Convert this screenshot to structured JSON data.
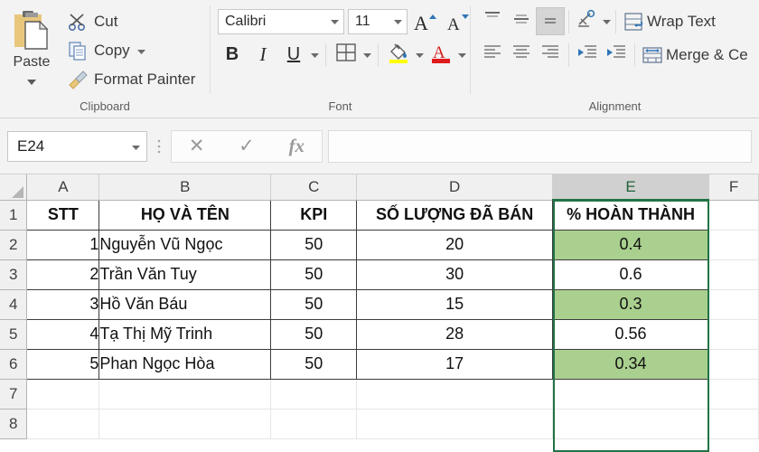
{
  "ribbon": {
    "clipboard": {
      "label": "Clipboard",
      "paste": {
        "label": "Paste",
        "icon": "clipboard-icon",
        "caret": "▾"
      },
      "commands": [
        {
          "label": "Cut",
          "icon": "scissors-icon",
          "caret": ""
        },
        {
          "label": "Copy",
          "icon": "copy-icon",
          "caret": "▾"
        },
        {
          "label": "Format Painter",
          "icon": "paintbrush-icon",
          "caret": ""
        }
      ]
    },
    "font": {
      "label": "Font",
      "font_name": "Calibri",
      "font_size": "11",
      "caret": "▾",
      "grow_font": "A",
      "shrink_font": "A",
      "bold": "B",
      "italic": "I",
      "underline": "U",
      "borders_icon": "borders-icon",
      "fill_color_icon": "fill-color-icon",
      "font_color_icon": "font-color-icon",
      "font_color_swatch": "#e01b1b",
      "fill_color_swatch": "#ffff00"
    },
    "alignment": {
      "label": "Alignment",
      "top_align": "top-align-icon",
      "middle_align": "middle-align-icon",
      "bottom_align": "bottom-align-icon",
      "orientation": "orientation-icon",
      "align_left": "align-left-icon",
      "align_center": "align-center-icon",
      "align_right": "align-right-icon",
      "decrease_indent": "decrease-indent-icon",
      "increase_indent": "increase-indent-icon",
      "wrap_text": "Wrap Text",
      "merge_center": "Merge & Ce"
    }
  },
  "formula_bar": {
    "name_box": "E24",
    "caret": "▾",
    "cancel": "✕",
    "enter": "✓",
    "insert_function": "fx",
    "formula_value": ""
  },
  "sheet": {
    "column_headers": [
      "A",
      "B",
      "C",
      "D",
      "E",
      "F"
    ],
    "selected_column": "E",
    "row_headers": [
      "1",
      "2",
      "3",
      "4",
      "5",
      "6",
      "7",
      "8"
    ],
    "table_headers": [
      "STT",
      "HỌ VÀ TÊN",
      "KPI",
      "SỐ LƯỢNG ĐÃ BÁN",
      "% HOÀN THÀNH"
    ],
    "rows": [
      {
        "stt": "1",
        "name": "Nguyễn Vũ Ngọc",
        "kpi": "50",
        "sold": "20",
        "pct": "0.4",
        "highlight": true
      },
      {
        "stt": "2",
        "name": "Trần Văn Tuy",
        "kpi": "50",
        "sold": "30",
        "pct": "0.6",
        "highlight": false
      },
      {
        "stt": "3",
        "name": "Hồ Văn Báu",
        "kpi": "50",
        "sold": "15",
        "pct": "0.3",
        "highlight": true
      },
      {
        "stt": "4",
        "name": "Tạ Thị Mỹ Trinh",
        "kpi": "50",
        "sold": "28",
        "pct": "0.56",
        "highlight": false
      },
      {
        "stt": "5",
        "name": "Phan Ngọc Hòa",
        "kpi": "50",
        "sold": "17",
        "pct": "0.34",
        "highlight": true
      }
    ],
    "highlight_color": "#a9d08e",
    "selection_color": "#217346"
  }
}
